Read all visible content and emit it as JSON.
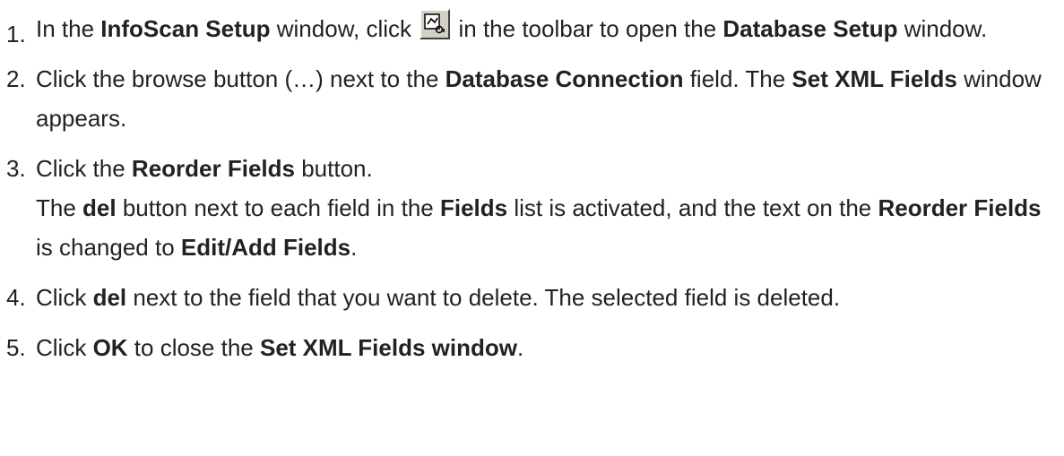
{
  "steps": [
    {
      "number": "1.",
      "parts": {
        "t1": "In the ",
        "b1": "InfoScan Setup",
        "t2": " window, click ",
        "t3": " in the toolbar to open the ",
        "b2": "Database Setup",
        "t4": " window."
      },
      "icon": "database-setup-toolbar-icon"
    },
    {
      "number": "2.",
      "parts": {
        "t1": "Click the browse button (…) next to the ",
        "b1": "Database Connection",
        "t2": " field. The ",
        "b2": "Set XML Fields",
        "t3": " window appears."
      }
    },
    {
      "number": "3.",
      "parts": {
        "t1": "Click the ",
        "b1": "Reorder Fields",
        "t2": " button.",
        "t3": "The ",
        "b2": "del",
        "t4": " button next to each field in the ",
        "b3": "Fields",
        "t5": " list is activated, and the text on the ",
        "b4": "Reorder Fields",
        "t6": " is changed to ",
        "b5": "Edit/Add Fields",
        "t7": "."
      }
    },
    {
      "number": "4.",
      "parts": {
        "t1": "Click ",
        "b1": "del",
        "t2": " next to the field that you want to delete. The selected field is deleted."
      }
    },
    {
      "number": "5.",
      "parts": {
        "t1": "Click ",
        "b1": "OK",
        "t2": " to close the ",
        "b2": "Set XML Fields window",
        "t3": "."
      }
    }
  ]
}
